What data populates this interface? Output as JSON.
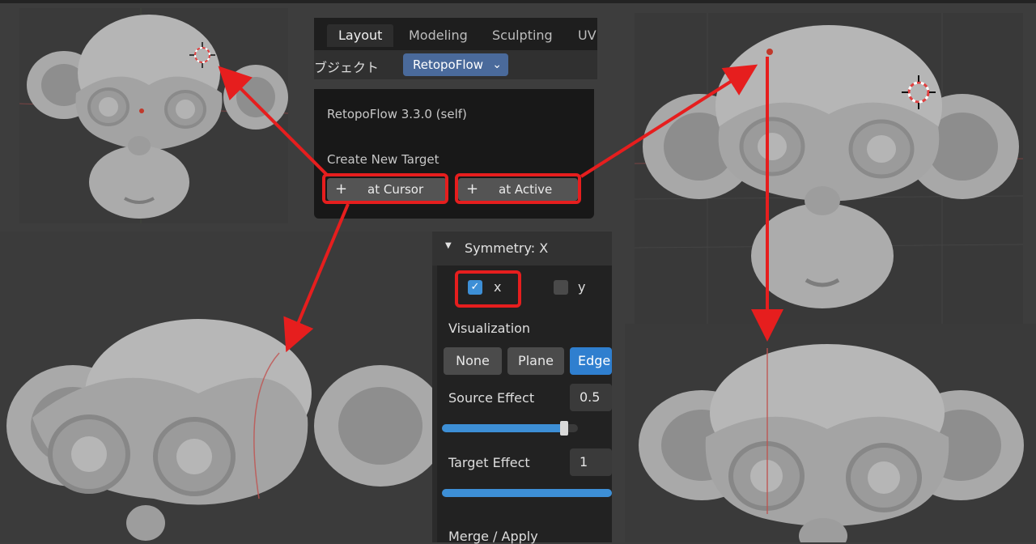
{
  "header": {
    "tabs": [
      {
        "label": "Layout",
        "active": true
      },
      {
        "label": "Modeling",
        "active": false
      },
      {
        "label": "Sculpting",
        "active": false
      },
      {
        "label": "UV",
        "active": false
      }
    ],
    "object_label": "ブジェクト",
    "addon_dropdown": "RetopoFlow"
  },
  "menu": {
    "version": "RetopoFlow 3.3.0 (self)",
    "section_title": "Create New Target",
    "btn_cursor": "at Cursor",
    "btn_active": "at Active",
    "plus": "+"
  },
  "panel": {
    "title": "Symmetry: X",
    "x_label": "x",
    "x_checked": true,
    "y_label": "y",
    "y_checked": false,
    "visualization_label": "Visualization",
    "vis_options": [
      {
        "label": "None",
        "selected": false
      },
      {
        "label": "Plane",
        "selected": false
      },
      {
        "label": "Edge",
        "selected": true
      }
    ],
    "source_effect_label": "Source Effect",
    "source_effect_value": "0.5",
    "source_effect_fraction": 0.9,
    "target_effect_label": "Target Effect",
    "target_effect_value": "1",
    "target_effect_fraction": 1.0,
    "merge_label": "Merge / Apply"
  },
  "colors": {
    "annotation_red": "#e61e1e",
    "accent_blue": "#3d8fd6"
  }
}
